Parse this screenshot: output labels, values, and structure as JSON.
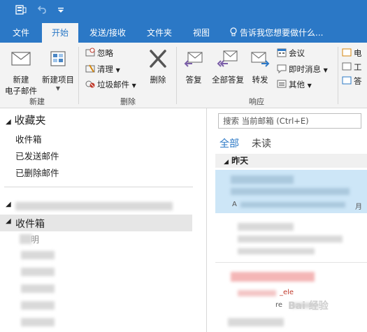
{
  "quick_access": {
    "icons": [
      "outlook-icon",
      "undo-icon",
      "customize-icon"
    ]
  },
  "tabs": {
    "file": "文件",
    "home": "开始",
    "send_receive": "发送/接收",
    "folder": "文件夹",
    "view": "视图",
    "tell_me": "告诉我您想要做什么..."
  },
  "ribbon": {
    "new_group": {
      "label": "新建",
      "new_email": "新建\n电子邮件",
      "new_email_line1": "新建",
      "new_email_line2": "电子邮件",
      "new_items": "新建项目"
    },
    "delete_group": {
      "label": "删除",
      "ignore": "忽略",
      "clean_up": "清理",
      "junk": "垃圾邮件",
      "delete": "删除"
    },
    "respond_group": {
      "label": "响应",
      "reply": "答复",
      "reply_all": "全部答复",
      "forward": "转发",
      "meeting": "会议",
      "im": "即时消息",
      "more": "其他"
    },
    "partial_items": [
      "电",
      "工",
      "答"
    ]
  },
  "nav": {
    "favorites": "收藏夹",
    "inbox": "收件箱",
    "sent": "已发送邮件",
    "deleted": "已删除邮件",
    "inbox_section": "收件箱",
    "partial_folder_char": "明"
  },
  "list": {
    "search_placeholder": "搜索 当前邮箱 (Ctrl+E)",
    "filter_all": "全部",
    "filter_unread": "未读",
    "date_group": "昨天",
    "partial_text_1": "A",
    "partial_text_2": "月",
    "partial_text_3": "_ele",
    "partial_text_4": "re"
  },
  "watermark": "Bai 经验",
  "colors": {
    "accent": "#2b78c6",
    "ribbon_bg": "#f3f3f3",
    "selected_row": "#cde6f7"
  }
}
